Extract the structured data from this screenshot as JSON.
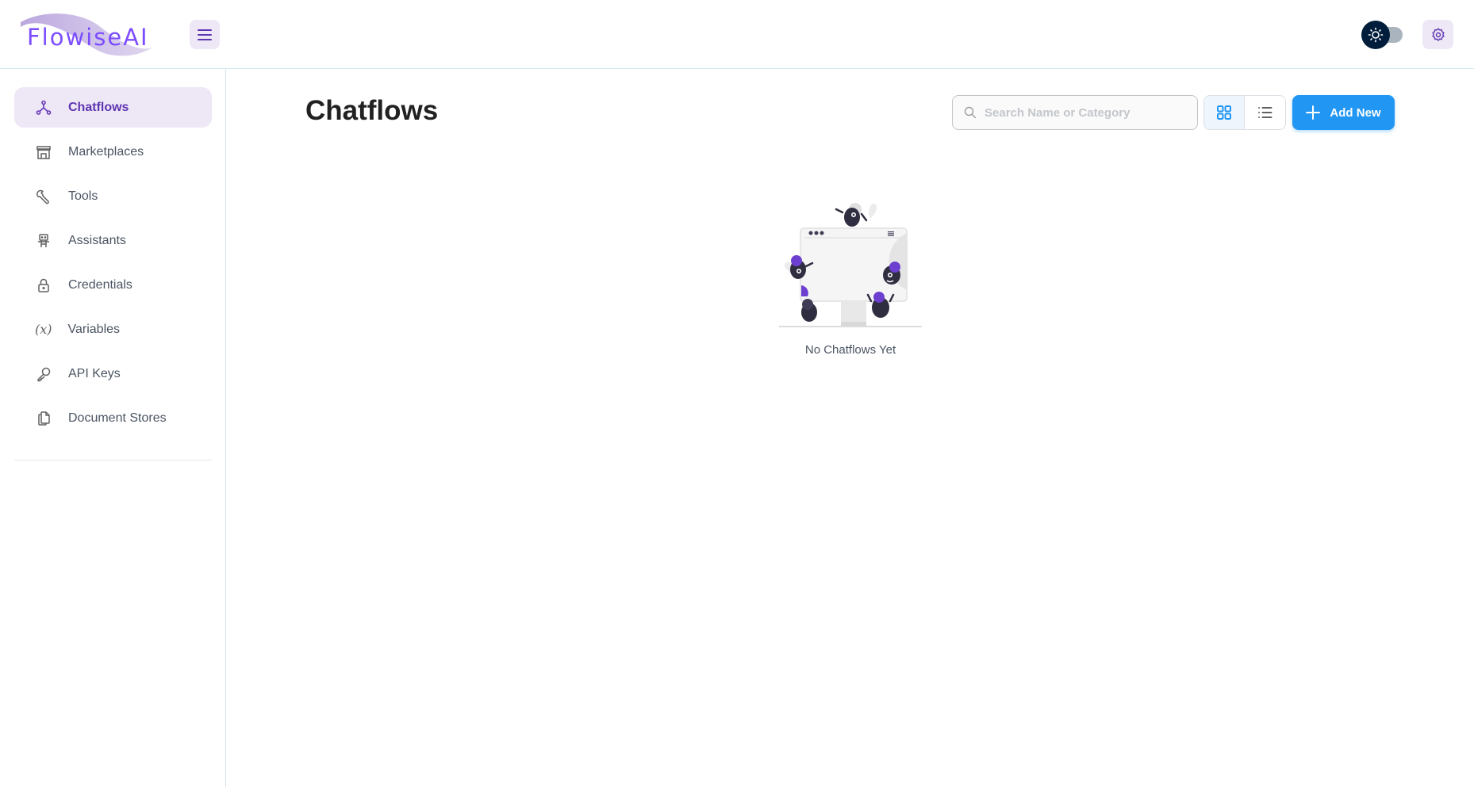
{
  "app": {
    "brand": "FlowiseAI",
    "accent_color": "#673ab7",
    "primary_color": "#2196f3"
  },
  "header": {
    "menu_icon": "hamburger-icon",
    "theme_toggle": {
      "icon": "sun-icon",
      "dark_mode": false
    },
    "settings_icon": "gear-icon"
  },
  "sidebar": {
    "items": [
      {
        "label": "Chatflows",
        "icon": "chatflow-nodes-icon",
        "active": true
      },
      {
        "label": "Marketplaces",
        "icon": "store-icon",
        "active": false
      },
      {
        "label": "Tools",
        "icon": "wrench-icon",
        "active": false
      },
      {
        "label": "Assistants",
        "icon": "robot-icon",
        "active": false
      },
      {
        "label": "Credentials",
        "icon": "lock-icon",
        "active": false
      },
      {
        "label": "Variables",
        "icon": "variable-icon",
        "active": false
      },
      {
        "label": "API Keys",
        "icon": "key-icon",
        "active": false
      },
      {
        "label": "Document Stores",
        "icon": "files-icon",
        "active": false
      }
    ]
  },
  "main": {
    "title": "Chatflows",
    "search": {
      "placeholder": "Search Name or Category",
      "value": ""
    },
    "view_toggle": {
      "options": [
        "card",
        "list"
      ],
      "selected": "card"
    },
    "add_button_label": "Add New",
    "empty_state": {
      "message": "No Chatflows Yet",
      "illustration": "empty-robots-illustration"
    }
  }
}
